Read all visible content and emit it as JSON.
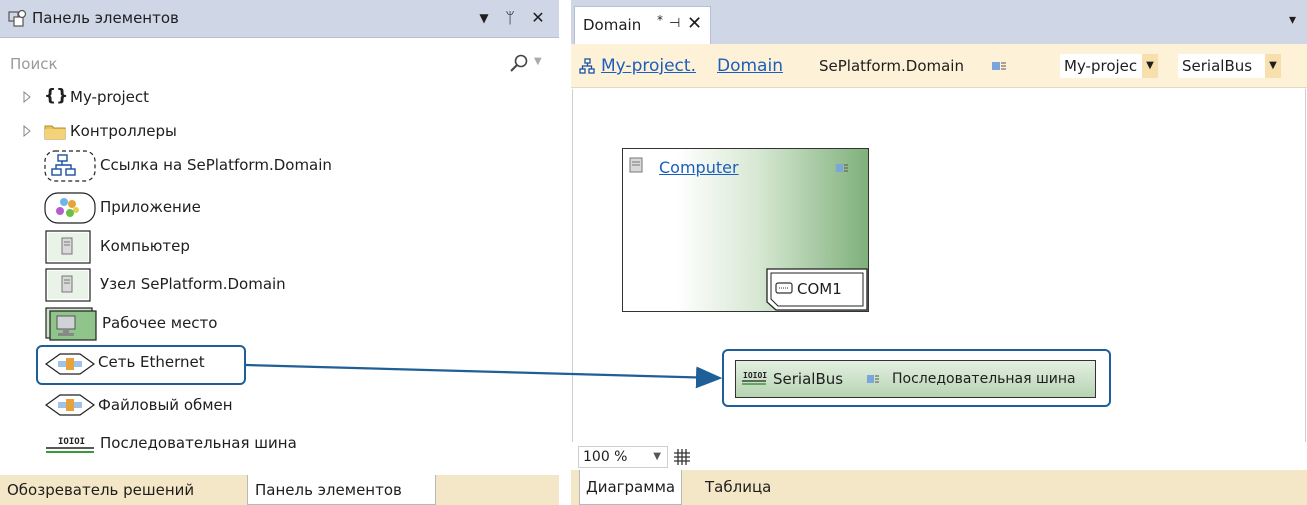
{
  "toolbox": {
    "title": "Панель элементов",
    "header_buttons": {
      "dropdown": "▼",
      "pin": "ᛘ",
      "close": "✕"
    },
    "search_placeholder": "Поиск",
    "items": [
      {
        "label": "My-project",
        "icon": "braces-icon"
      },
      {
        "label": "Контроллеры",
        "icon": "folder-icon"
      },
      {
        "label": "Ссылка на SePlatform.Domain",
        "icon": "domain-link-icon"
      },
      {
        "label": "Приложение",
        "icon": "application-icon"
      },
      {
        "label": "Компьютер",
        "icon": "computer-icon"
      },
      {
        "label": "Узел SePlatform.Domain",
        "icon": "domain-node-icon"
      },
      {
        "label": "Рабочее место",
        "icon": "workstation-icon"
      },
      {
        "label": "Сеть Ethernet",
        "icon": "ethernet-icon"
      },
      {
        "label": "Файловый обмен",
        "icon": "file-exchange-icon"
      },
      {
        "label": "Последовательная шина",
        "icon": "serial-bus-icon"
      }
    ],
    "bottom_tabs": [
      "Обозреватель решений",
      "Панель элементов"
    ],
    "active_tab": "Панель элементов"
  },
  "designer": {
    "doc_tab": {
      "name": "Domain",
      "modified": "*",
      "pin": "⊣",
      "close": "✕"
    },
    "overflow_menu": "▾",
    "breadcrumb": {
      "project_link": "My-project.",
      "domain_link": "Domain",
      "type": "SePlatform.Domain",
      "project_combo": "My-projec",
      "bus_combo": "SerialBus"
    },
    "computer_node": {
      "name": "Computer",
      "port": "COM1"
    },
    "bus_node": {
      "name": "SerialBus",
      "type": "Последовательная шина"
    },
    "zoom": "100 %",
    "view_tabs": [
      "Диаграмма",
      "Таблица"
    ],
    "active_view": "Диаграмма"
  },
  "colors": {
    "header_bg": "#cfd6e5",
    "tab_strip_bg": "#f4e7c7",
    "breadcrumb_bg": "#fdf1d8",
    "link": "#1b5ebe",
    "highlight": "#1f5f97",
    "node_green": "#7fb07b"
  }
}
